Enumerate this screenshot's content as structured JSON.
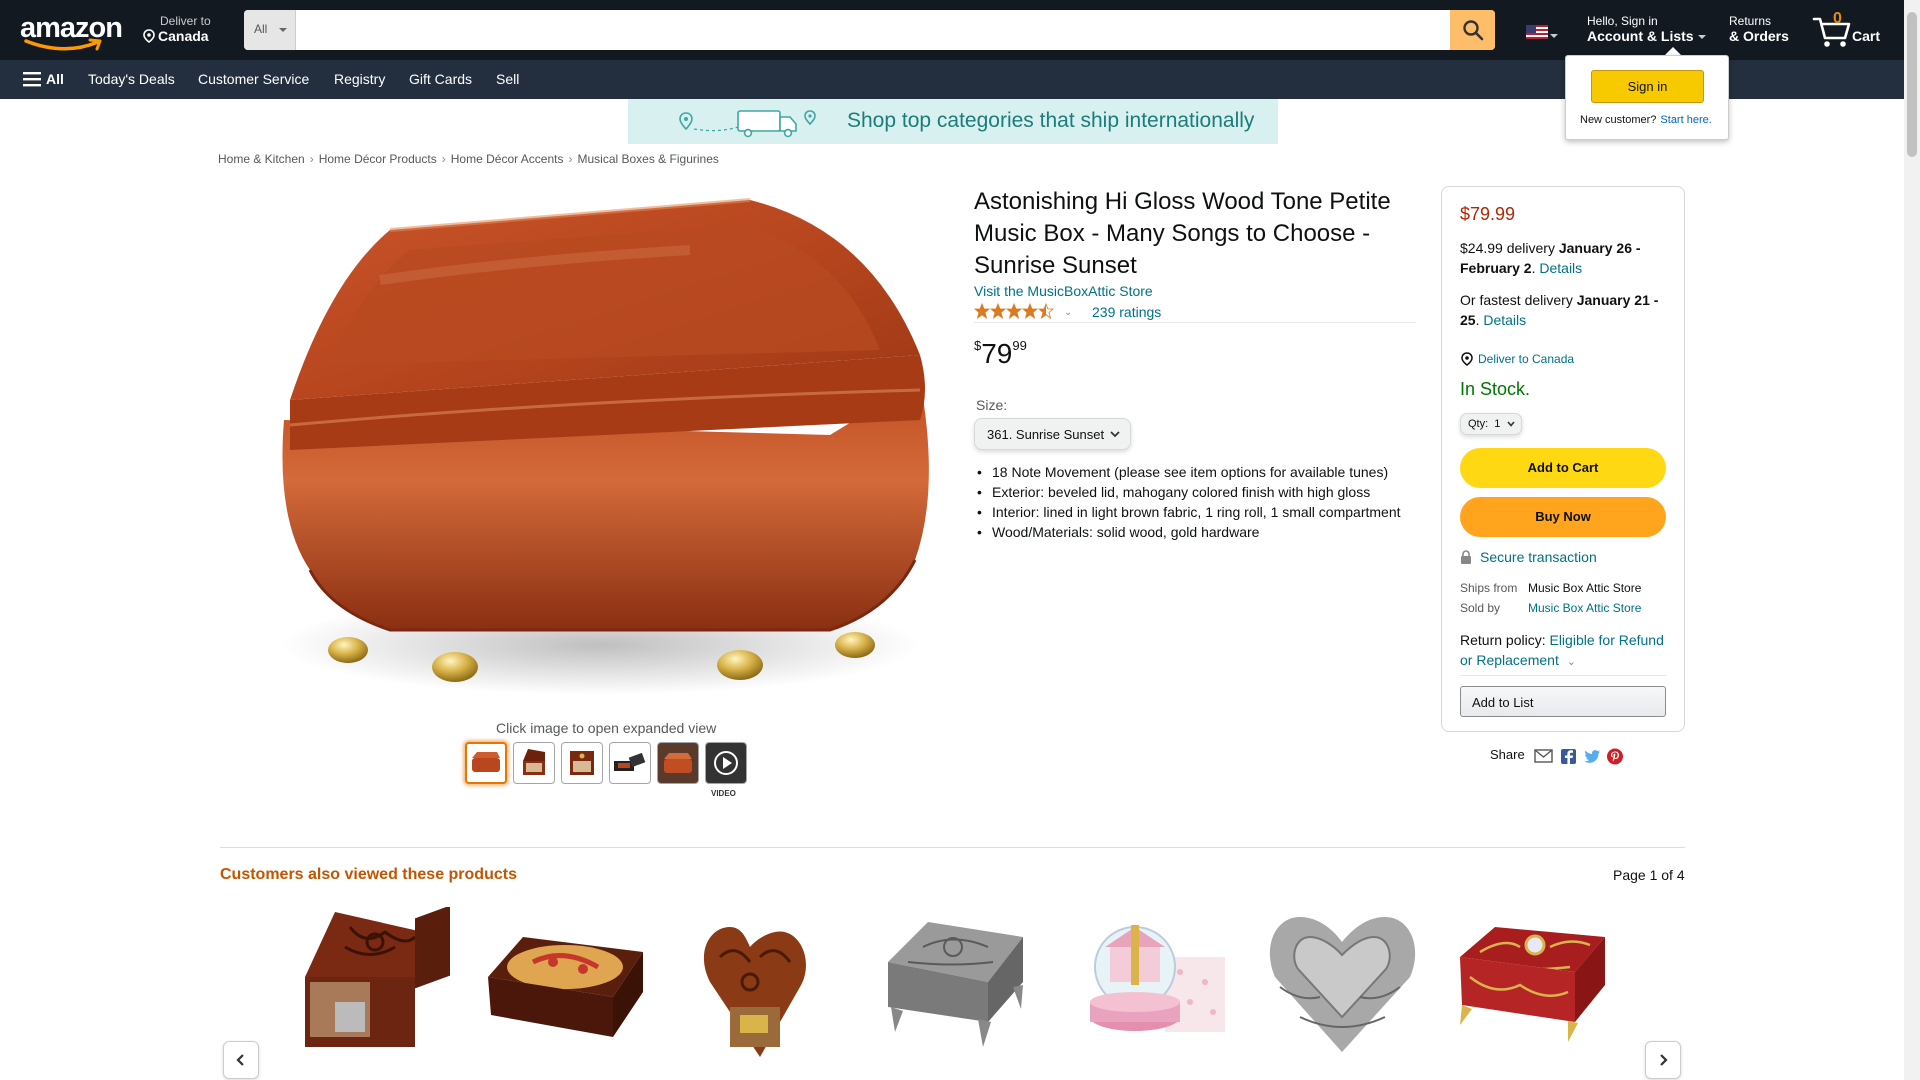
{
  "header": {
    "logo": "amazon",
    "deliver_small": "Deliver to",
    "deliver_big": "Canada",
    "search_category": "All",
    "search_placeholder": "",
    "account_small": "Hello, Sign in",
    "account_big": "Account & Lists",
    "returns_small": "Returns",
    "returns_big": "& Orders",
    "cart_count": "0",
    "cart_label": "Cart"
  },
  "subnav": {
    "all_label": "All",
    "items": [
      "Today's Deals",
      "Customer Service",
      "Registry",
      "Gift Cards",
      "Sell"
    ]
  },
  "flyout": {
    "signin_label": "Sign in",
    "new_customer": "New customer?",
    "start_here": "Start here."
  },
  "banner": {
    "text": "Shop top categories that ship internationally"
  },
  "breadcrumb": [
    "Home & Kitchen",
    "Home Décor Products",
    "Home Décor Accents",
    "Musical Boxes & Figurines"
  ],
  "gallery": {
    "caption": "Click image to open expanded view",
    "video_label": "VIDEO"
  },
  "product": {
    "title": "Astonishing Hi Gloss Wood Tone Petite Music Box - Many Songs to Choose - Sunrise Sunset",
    "store_link": "Visit the MusicBoxAttic Store",
    "rating_stars": 4.5,
    "ratings_count": "239 ratings",
    "price_symbol": "$",
    "price_whole": "79",
    "price_fraction": "99",
    "size_label": "Size:",
    "size_value": "361. Sunrise Sunset",
    "bullets": [
      "18 Note Movement (please see item options for available tunes)",
      "Exterior: beveled lid, mahogany colored finish with high gloss",
      "Interior: lined in light brown fabric, 1 ring roll, 1 small compartment",
      "Wood/Materials: solid wood, gold hardware"
    ]
  },
  "buybox": {
    "price": "$79.99",
    "delivery1_prefix": "$24.99 delivery ",
    "delivery1_date": "January 26 - February 2",
    "delivery1_link": "Details",
    "delivery2_prefix": "Or fastest delivery ",
    "delivery2_date": "January 21 - 25",
    "delivery2_link": "Details",
    "deliver_to": "Deliver to Canada",
    "stock": "In Stock.",
    "qty_label": "Qty:",
    "qty_value": "1",
    "add_to_cart": "Add to Cart",
    "buy_now": "Buy Now",
    "secure": "Secure transaction",
    "ships_from_label": "Ships from",
    "ships_from_value": "Music Box Attic Store",
    "sold_by_label": "Sold by",
    "sold_by_value": "Music Box Attic Store",
    "return_prefix": "Return policy: ",
    "return_link": "Eligible for Refund or Replacement",
    "add_to_list": "Add to List"
  },
  "share": {
    "label": "Share"
  },
  "carousel": {
    "title": "Customers also viewed these products",
    "page": "Page 1 of 4"
  },
  "colors": {
    "nav_dark": "#131921",
    "nav_sub": "#232f3e",
    "accent_orange": "#febd69",
    "price_red": "#b12704",
    "link": "#007185",
    "stock_green": "#007600",
    "cart_yellow": "#ffd814",
    "buy_orange": "#ffa41c"
  }
}
